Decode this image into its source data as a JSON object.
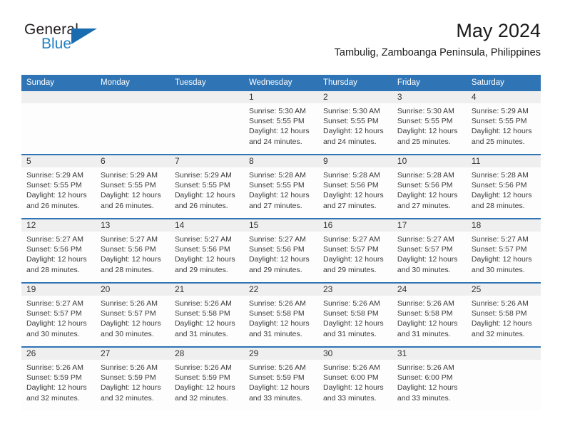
{
  "brand": {
    "name_top": "General",
    "name_bottom": "Blue",
    "color_blue": "#1e7fc4",
    "color_dark": "#231f20"
  },
  "header": {
    "title": "May 2024",
    "subtitle": "Tambulig, Zamboanga Peninsula, Philippines"
  },
  "theme": {
    "header_blue": "#2f74b5",
    "daynum_band": "#efefef",
    "cell_background": "#fdfdfd"
  },
  "weekday_headers": [
    "Sunday",
    "Monday",
    "Tuesday",
    "Wednesday",
    "Thursday",
    "Friday",
    "Saturday"
  ],
  "labels": {
    "sunrise_prefix": "Sunrise: ",
    "sunset_prefix": "Sunset: ",
    "daylight_prefix": "Daylight: "
  },
  "weeks": [
    [
      {
        "empty": true
      },
      {
        "empty": true
      },
      {
        "empty": true
      },
      {
        "day": "1",
        "sunrise": "Sunrise: 5:30 AM",
        "sunset": "Sunset: 5:55 PM",
        "daylight1": "Daylight: 12 hours",
        "daylight2": "and 24 minutes."
      },
      {
        "day": "2",
        "sunrise": "Sunrise: 5:30 AM",
        "sunset": "Sunset: 5:55 PM",
        "daylight1": "Daylight: 12 hours",
        "daylight2": "and 24 minutes."
      },
      {
        "day": "3",
        "sunrise": "Sunrise: 5:30 AM",
        "sunset": "Sunset: 5:55 PM",
        "daylight1": "Daylight: 12 hours",
        "daylight2": "and 25 minutes."
      },
      {
        "day": "4",
        "sunrise": "Sunrise: 5:29 AM",
        "sunset": "Sunset: 5:55 PM",
        "daylight1": "Daylight: 12 hours",
        "daylight2": "and 25 minutes."
      }
    ],
    [
      {
        "day": "5",
        "sunrise": "Sunrise: 5:29 AM",
        "sunset": "Sunset: 5:55 PM",
        "daylight1": "Daylight: 12 hours",
        "daylight2": "and 26 minutes."
      },
      {
        "day": "6",
        "sunrise": "Sunrise: 5:29 AM",
        "sunset": "Sunset: 5:55 PM",
        "daylight1": "Daylight: 12 hours",
        "daylight2": "and 26 minutes."
      },
      {
        "day": "7",
        "sunrise": "Sunrise: 5:29 AM",
        "sunset": "Sunset: 5:55 PM",
        "daylight1": "Daylight: 12 hours",
        "daylight2": "and 26 minutes."
      },
      {
        "day": "8",
        "sunrise": "Sunrise: 5:28 AM",
        "sunset": "Sunset: 5:55 PM",
        "daylight1": "Daylight: 12 hours",
        "daylight2": "and 27 minutes."
      },
      {
        "day": "9",
        "sunrise": "Sunrise: 5:28 AM",
        "sunset": "Sunset: 5:56 PM",
        "daylight1": "Daylight: 12 hours",
        "daylight2": "and 27 minutes."
      },
      {
        "day": "10",
        "sunrise": "Sunrise: 5:28 AM",
        "sunset": "Sunset: 5:56 PM",
        "daylight1": "Daylight: 12 hours",
        "daylight2": "and 27 minutes."
      },
      {
        "day": "11",
        "sunrise": "Sunrise: 5:28 AM",
        "sunset": "Sunset: 5:56 PM",
        "daylight1": "Daylight: 12 hours",
        "daylight2": "and 28 minutes."
      }
    ],
    [
      {
        "day": "12",
        "sunrise": "Sunrise: 5:27 AM",
        "sunset": "Sunset: 5:56 PM",
        "daylight1": "Daylight: 12 hours",
        "daylight2": "and 28 minutes."
      },
      {
        "day": "13",
        "sunrise": "Sunrise: 5:27 AM",
        "sunset": "Sunset: 5:56 PM",
        "daylight1": "Daylight: 12 hours",
        "daylight2": "and 28 minutes."
      },
      {
        "day": "14",
        "sunrise": "Sunrise: 5:27 AM",
        "sunset": "Sunset: 5:56 PM",
        "daylight1": "Daylight: 12 hours",
        "daylight2": "and 29 minutes."
      },
      {
        "day": "15",
        "sunrise": "Sunrise: 5:27 AM",
        "sunset": "Sunset: 5:56 PM",
        "daylight1": "Daylight: 12 hours",
        "daylight2": "and 29 minutes."
      },
      {
        "day": "16",
        "sunrise": "Sunrise: 5:27 AM",
        "sunset": "Sunset: 5:57 PM",
        "daylight1": "Daylight: 12 hours",
        "daylight2": "and 29 minutes."
      },
      {
        "day": "17",
        "sunrise": "Sunrise: 5:27 AM",
        "sunset": "Sunset: 5:57 PM",
        "daylight1": "Daylight: 12 hours",
        "daylight2": "and 30 minutes."
      },
      {
        "day": "18",
        "sunrise": "Sunrise: 5:27 AM",
        "sunset": "Sunset: 5:57 PM",
        "daylight1": "Daylight: 12 hours",
        "daylight2": "and 30 minutes."
      }
    ],
    [
      {
        "day": "19",
        "sunrise": "Sunrise: 5:27 AM",
        "sunset": "Sunset: 5:57 PM",
        "daylight1": "Daylight: 12 hours",
        "daylight2": "and 30 minutes."
      },
      {
        "day": "20",
        "sunrise": "Sunrise: 5:26 AM",
        "sunset": "Sunset: 5:57 PM",
        "daylight1": "Daylight: 12 hours",
        "daylight2": "and 30 minutes."
      },
      {
        "day": "21",
        "sunrise": "Sunrise: 5:26 AM",
        "sunset": "Sunset: 5:58 PM",
        "daylight1": "Daylight: 12 hours",
        "daylight2": "and 31 minutes."
      },
      {
        "day": "22",
        "sunrise": "Sunrise: 5:26 AM",
        "sunset": "Sunset: 5:58 PM",
        "daylight1": "Daylight: 12 hours",
        "daylight2": "and 31 minutes."
      },
      {
        "day": "23",
        "sunrise": "Sunrise: 5:26 AM",
        "sunset": "Sunset: 5:58 PM",
        "daylight1": "Daylight: 12 hours",
        "daylight2": "and 31 minutes."
      },
      {
        "day": "24",
        "sunrise": "Sunrise: 5:26 AM",
        "sunset": "Sunset: 5:58 PM",
        "daylight1": "Daylight: 12 hours",
        "daylight2": "and 31 minutes."
      },
      {
        "day": "25",
        "sunrise": "Sunrise: 5:26 AM",
        "sunset": "Sunset: 5:58 PM",
        "daylight1": "Daylight: 12 hours",
        "daylight2": "and 32 minutes."
      }
    ],
    [
      {
        "day": "26",
        "sunrise": "Sunrise: 5:26 AM",
        "sunset": "Sunset: 5:59 PM",
        "daylight1": "Daylight: 12 hours",
        "daylight2": "and 32 minutes."
      },
      {
        "day": "27",
        "sunrise": "Sunrise: 5:26 AM",
        "sunset": "Sunset: 5:59 PM",
        "daylight1": "Daylight: 12 hours",
        "daylight2": "and 32 minutes."
      },
      {
        "day": "28",
        "sunrise": "Sunrise: 5:26 AM",
        "sunset": "Sunset: 5:59 PM",
        "daylight1": "Daylight: 12 hours",
        "daylight2": "and 32 minutes."
      },
      {
        "day": "29",
        "sunrise": "Sunrise: 5:26 AM",
        "sunset": "Sunset: 5:59 PM",
        "daylight1": "Daylight: 12 hours",
        "daylight2": "and 33 minutes."
      },
      {
        "day": "30",
        "sunrise": "Sunrise: 5:26 AM",
        "sunset": "Sunset: 6:00 PM",
        "daylight1": "Daylight: 12 hours",
        "daylight2": "and 33 minutes."
      },
      {
        "day": "31",
        "sunrise": "Sunrise: 5:26 AM",
        "sunset": "Sunset: 6:00 PM",
        "daylight1": "Daylight: 12 hours",
        "daylight2": "and 33 minutes."
      },
      {
        "empty": true
      }
    ]
  ]
}
